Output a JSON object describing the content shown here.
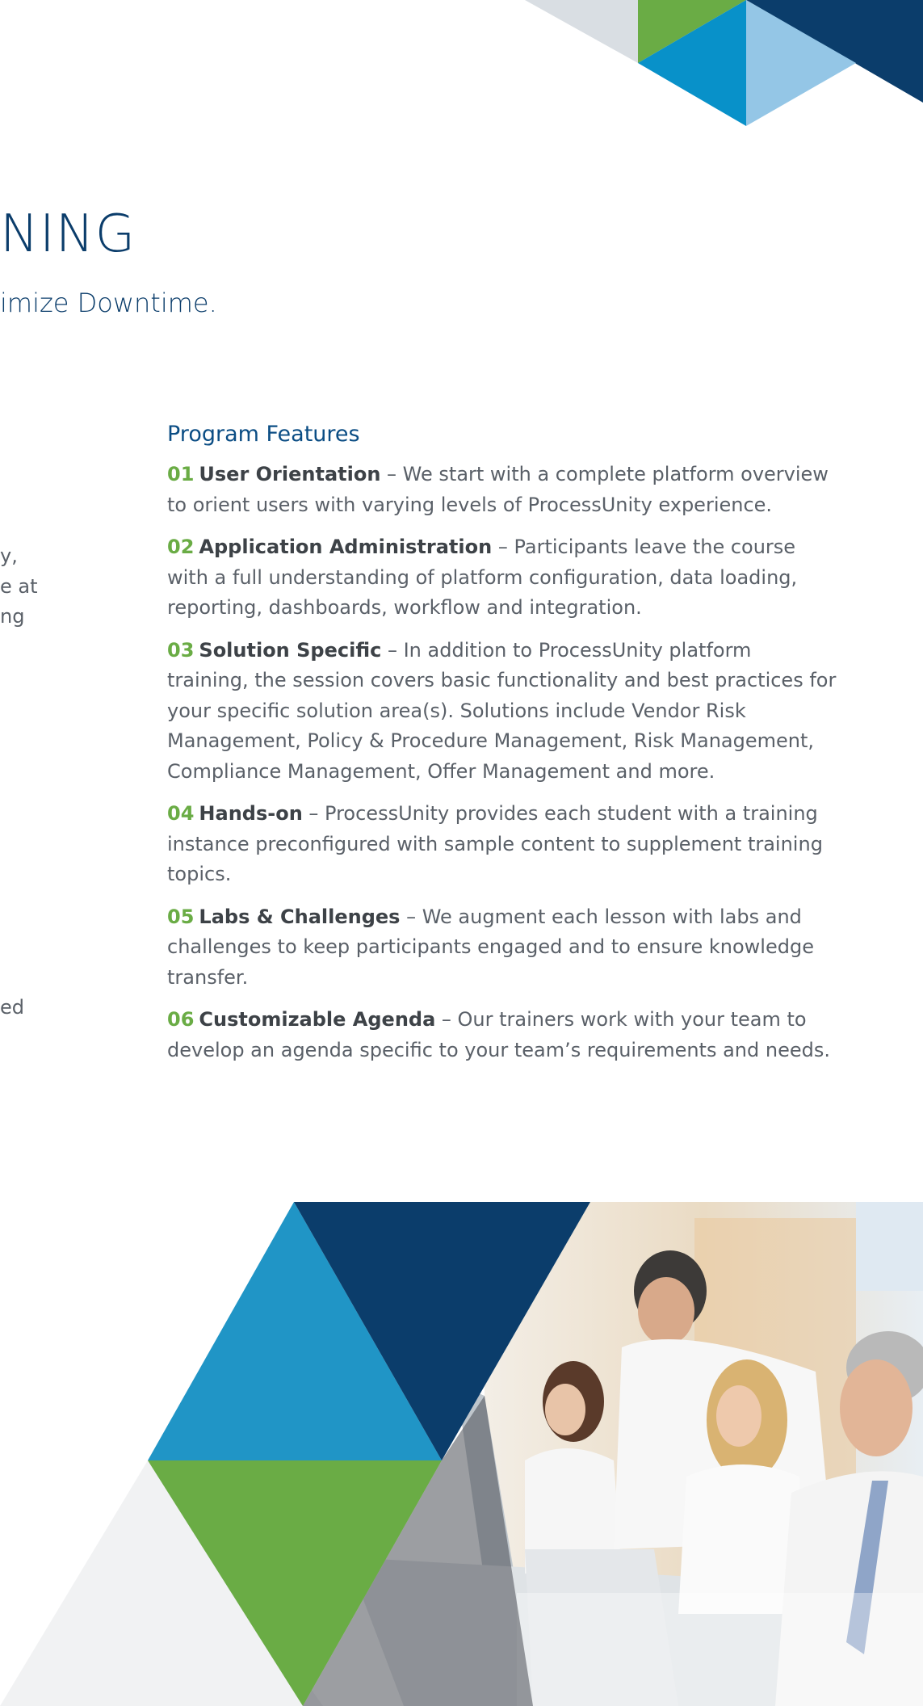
{
  "page": {
    "title": "NING",
    "subtitle": "imize Downtime."
  },
  "left_fragments": [
    "y,",
    "e at",
    "ng",
    "ed"
  ],
  "program_features": {
    "heading": "Program Features",
    "items": [
      {
        "number": "01",
        "name": "User Orientation",
        "text": " – We start with a complete platform overview to orient users with varying levels of ProcessUnity experience."
      },
      {
        "number": "02",
        "name": "Application Administration",
        "text": " – Participants leave the course with a full understanding of platform configuration, data loading, reporting, dashboards, workflow and integration."
      },
      {
        "number": "03",
        "name": "Solution Specific",
        "text": " – In addition to ProcessUnity platform training, the session covers basic functionality and best practices for your specific solution area(s). Solutions include Vendor Risk Management, Policy & Procedure Management, Risk Management, Compliance Management, Offer Management and more."
      },
      {
        "number": "04",
        "name": "Hands-on",
        "text": " – ProcessUnity provides each student with a training instance preconfigured with sample content to supplement training topics."
      },
      {
        "number": "05",
        "name": "Labs & Challenges",
        "text": " – We augment each lesson with labs and challenges to keep participants engaged and to ensure knowledge transfer."
      },
      {
        "number": "06",
        "name": "Customizable Agenda",
        "text": " – Our trainers work with your team to develop an agenda specific to your team’s requirements and needs."
      }
    ]
  },
  "colors": {
    "navy": "#0b3d6b",
    "blue": "#0891c9",
    "light_blue": "#94c6e6",
    "green": "#6aac45",
    "light_gray": "#d9dee3",
    "text": "#5a6068"
  }
}
